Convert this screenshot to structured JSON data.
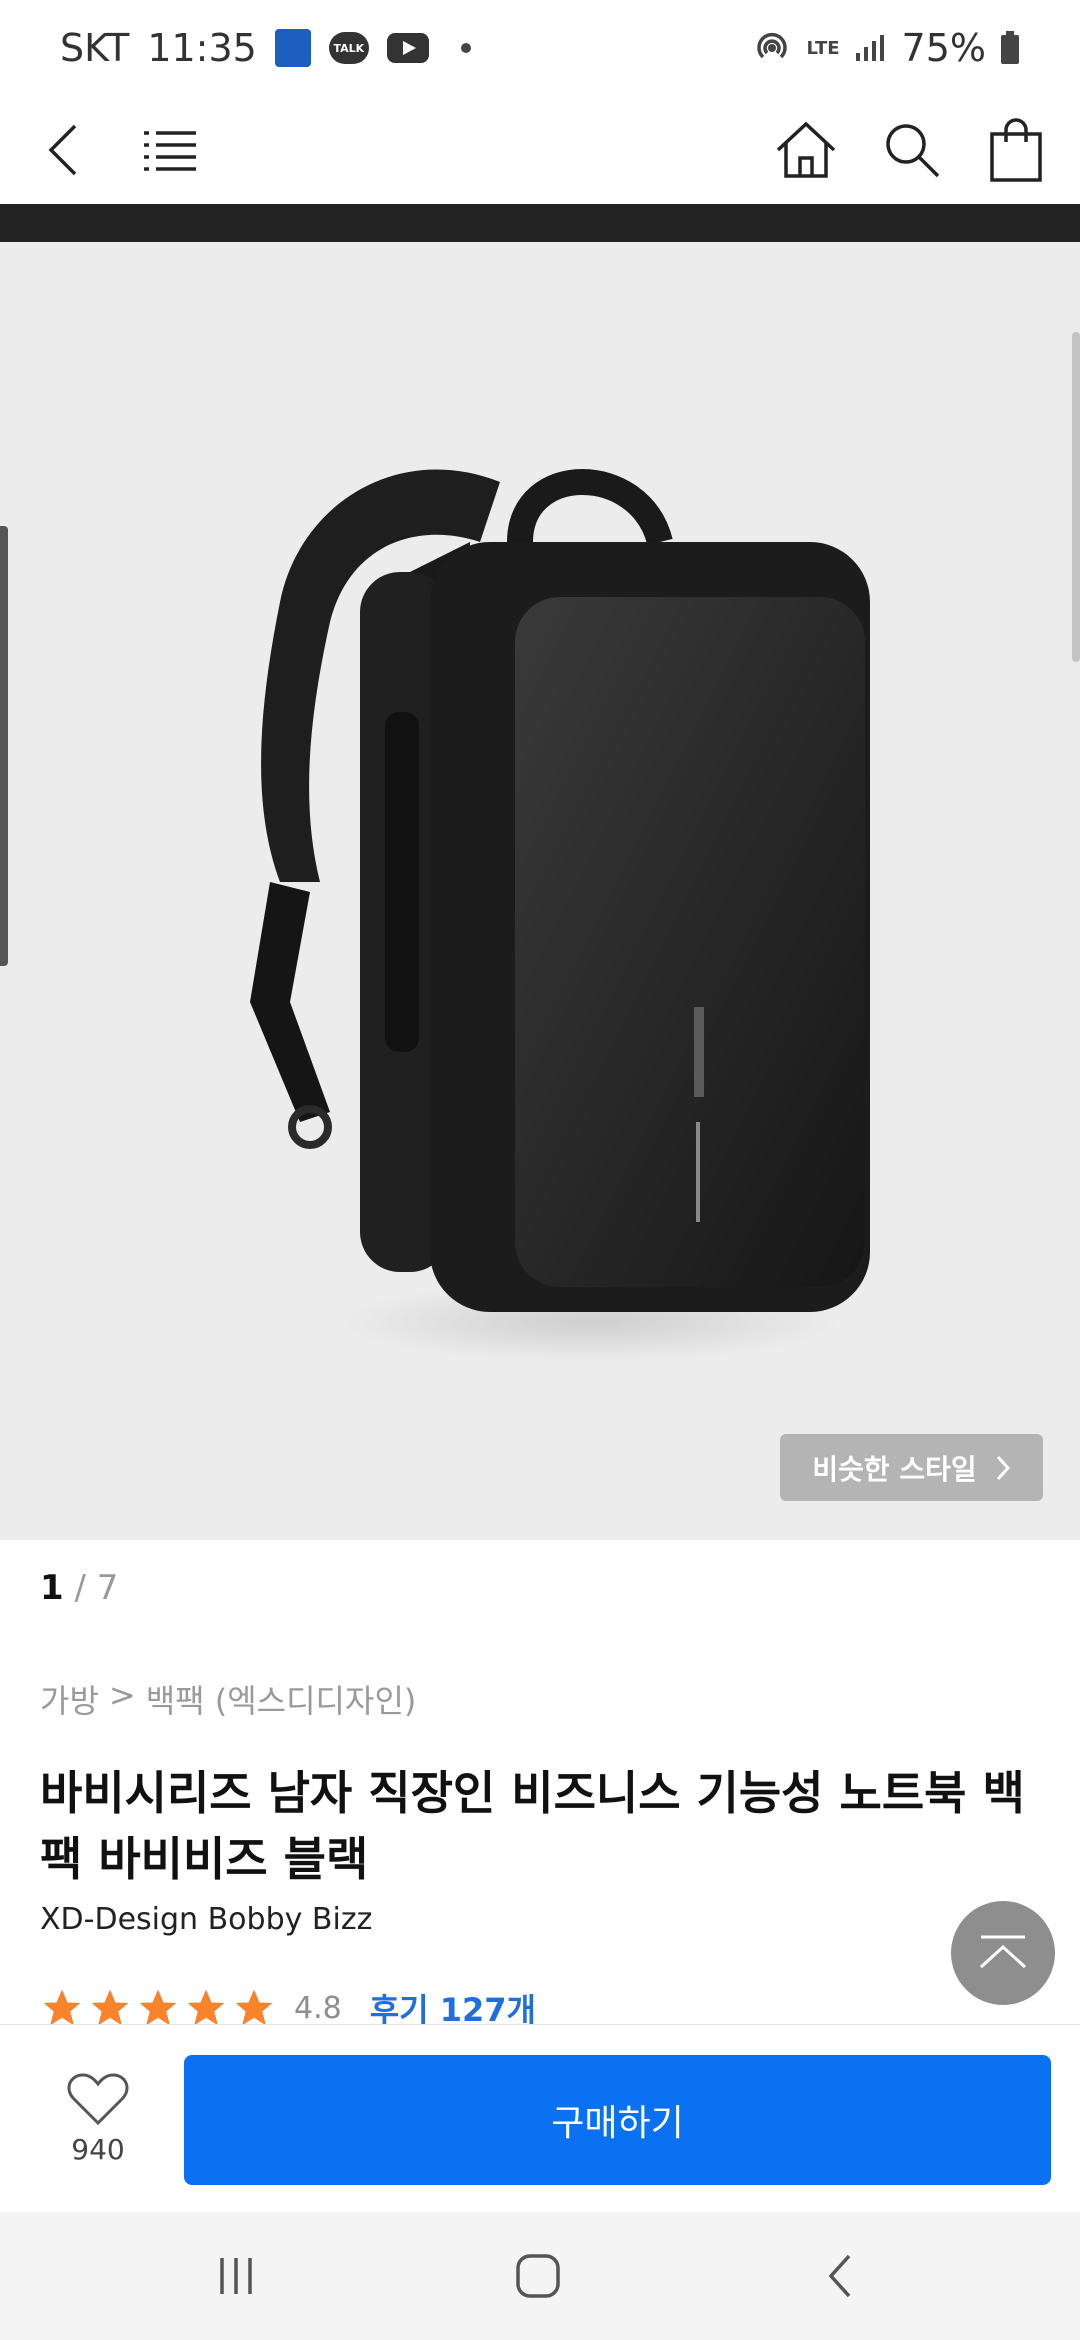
{
  "status_bar": {
    "carrier": "SKT",
    "time": "11:35",
    "talk_label": "TALK",
    "network": "LTE",
    "battery": "75%"
  },
  "header": {
    "icons": [
      "back-icon",
      "menu-icon",
      "home-icon",
      "search-icon",
      "shopping-bag-icon"
    ]
  },
  "product_image": {
    "similar_style_label": "비슷한 스타일"
  },
  "pager": {
    "current": "1",
    "separator": "/",
    "total": "7"
  },
  "breadcrumb": {
    "category": "가방",
    "separator": ">",
    "subcategory": "백팩 (엑스디디자인)"
  },
  "product": {
    "title": "바비시리즈 남자 직장인 비즈니스 기능성 노트북 백팩 바비비즈 블랙",
    "subtitle": "XD-Design Bobby Bizz",
    "rating_score": "4.8",
    "stars": 5,
    "review_link": "후기 127개"
  },
  "bottom_bar": {
    "like_count": "940",
    "buy_label": "구매하기"
  },
  "colors": {
    "accent": "#0a72f2",
    "star": "#f5842a",
    "review_link": "#1e6fe0"
  }
}
